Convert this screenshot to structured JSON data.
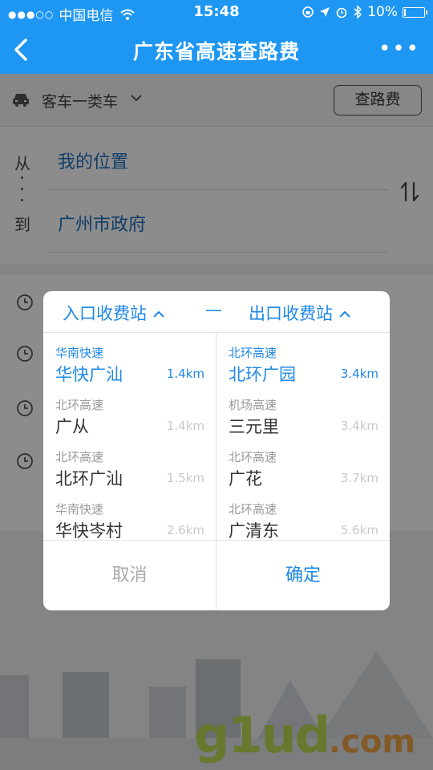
{
  "status_bar": {
    "carrier": "中国电信",
    "time": "15:48",
    "battery": "10%",
    "battery_level": 0.1
  },
  "nav": {
    "title": "广东省高速查路费",
    "back_icon": "chevron-left-icon",
    "more_icon": "more-dots-icon",
    "more_label": "•••"
  },
  "vehicle": {
    "label": "客车一类车",
    "query_label": "查路费"
  },
  "route": {
    "from_char": "从",
    "to_char": "到",
    "from_value": "我的位置",
    "to_value": "广州市政府"
  },
  "modal": {
    "entry_title": "入口收费站",
    "separator": "—",
    "exit_title": "出口收费站",
    "entries": [
      {
        "road": "华南快速",
        "name": "华快广汕",
        "dist": "1.4km",
        "selected": true
      },
      {
        "road": "北环高速",
        "name": "广从",
        "dist": "1.4km",
        "selected": false
      },
      {
        "road": "北环高速",
        "name": "北环广汕",
        "dist": "1.5km",
        "selected": false
      },
      {
        "road": "华南快速",
        "name": "华快岑村",
        "dist": "2.6km",
        "selected": false
      }
    ],
    "exits": [
      {
        "road": "北环高速",
        "name": "北环广园",
        "dist": "3.4km",
        "selected": true
      },
      {
        "road": "机场高速",
        "name": "三元里",
        "dist": "3.4km",
        "selected": false
      },
      {
        "road": "北环高速",
        "name": "广花",
        "dist": "3.7km",
        "selected": false
      },
      {
        "road": "北环高速",
        "name": "广清东",
        "dist": "5.6km",
        "selected": false
      }
    ],
    "cancel_label": "取消",
    "ok_label": "确定"
  },
  "watermark": {
    "main": "g1ud",
    "suffix": ".com"
  },
  "colors": {
    "brand": "#1e97f3",
    "accent": "#1e88e5"
  }
}
